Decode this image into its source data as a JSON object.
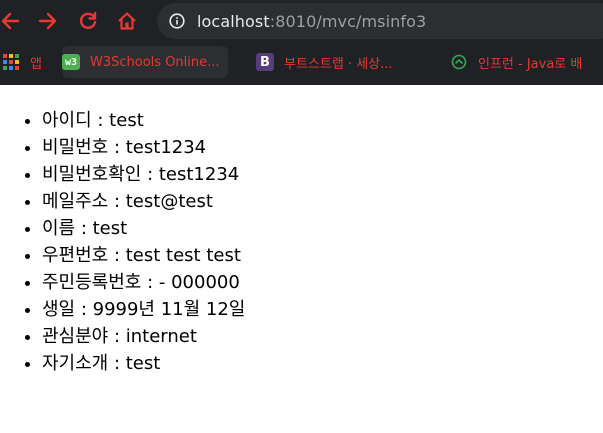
{
  "browser": {
    "url_host": "localhost",
    "url_rest": ":8010/mvc/msinfo3",
    "icons": {
      "back": "arrow-left-icon",
      "forward": "arrow-right-icon",
      "reload": "reload-icon",
      "home": "home-icon",
      "site_info": "info-icon"
    },
    "accent_color": "#e53935"
  },
  "bookmarks": [
    {
      "label": "앱",
      "icon": "apps-grid-icon"
    },
    {
      "label": "W3Schools Online...",
      "icon": "w3schools-icon",
      "badge": "w3"
    },
    {
      "label": "부트스트랩 · 세상...",
      "icon": "bootstrap-icon",
      "badge": "B"
    },
    {
      "label": "인프런 - Java로 배",
      "icon": "inflearn-icon"
    }
  ],
  "info": [
    "아이디 : test",
    "비밀번호 : test1234",
    "비밀번호확인 : test1234",
    "메일주소 : test@test",
    "이름 : test",
    "우편번호 : test test test",
    "주민등록번호 : - 000000",
    "생일 : 9999년 11월 12일",
    "관심분야 : internet",
    "자기소개 : test"
  ]
}
